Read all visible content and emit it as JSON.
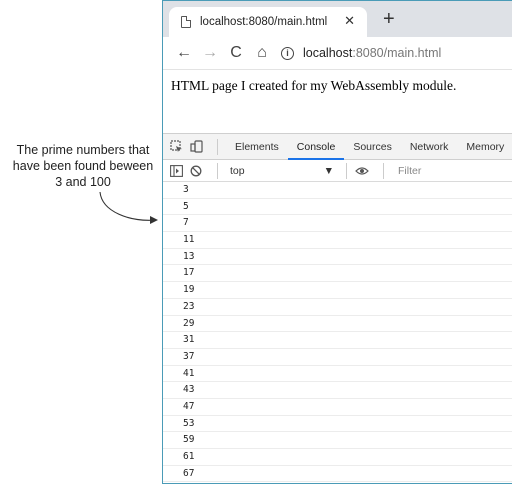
{
  "annotation": {
    "text_line1": "The prime numbers that",
    "text_line2": "have been found beween",
    "text_line3": "3 and 100"
  },
  "browser": {
    "tab": {
      "title": "localhost:8080/main.html",
      "close_glyph": "✕"
    },
    "new_tab_glyph": "+",
    "toolbar": {
      "back_glyph": "←",
      "forward_glyph": "→",
      "reload_glyph": "C",
      "home_glyph": "⌂",
      "url_host": "localhost",
      "url_rest": ":8080/main.html"
    },
    "page_text": "HTML page I created for my WebAssembly module."
  },
  "devtools": {
    "tabs": [
      "Elements",
      "Console",
      "Sources",
      "Network",
      "Memory"
    ],
    "active_tab": "Console",
    "context": "top",
    "filter_placeholder": "Filter",
    "console_output": [
      "3",
      "5",
      "7",
      "11",
      "13",
      "17",
      "19",
      "23",
      "29",
      "31",
      "37",
      "41",
      "43",
      "47",
      "53",
      "59",
      "61",
      "67"
    ]
  },
  "colors": {
    "border_accent": "#4a9bb7",
    "active_tab_underline": "#1a73e8"
  }
}
